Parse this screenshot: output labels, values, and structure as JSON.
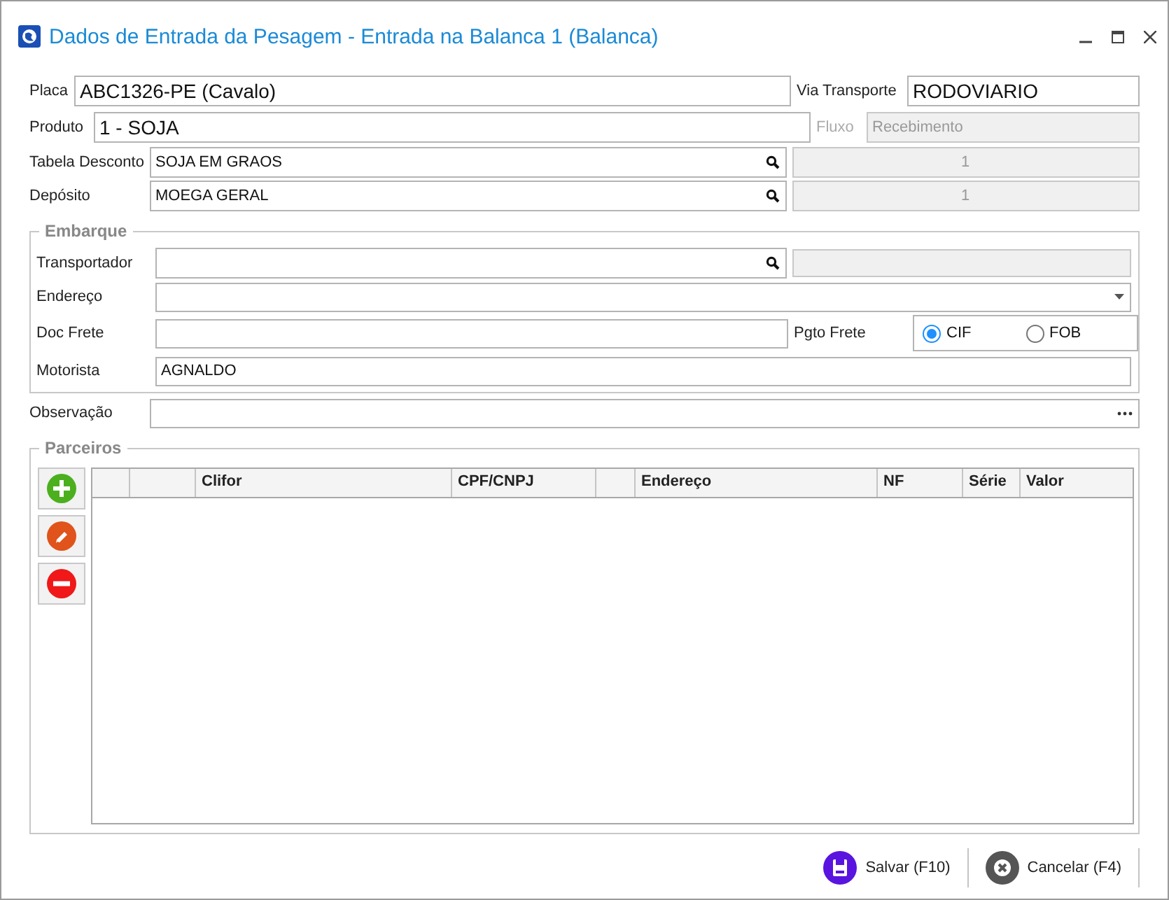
{
  "window": {
    "title": "Dados de Entrada da Pesagem - Entrada na Balanca 1 (Balanca)"
  },
  "placa": {
    "label": "Placa",
    "value": "ABC1326-PE (Cavalo)"
  },
  "via_transporte": {
    "label": "Via Transporte",
    "value": "RODOVIARIO"
  },
  "produto": {
    "label": "Produto",
    "value": "1 - SOJA"
  },
  "fluxo": {
    "label": "Fluxo",
    "value": "Recebimento",
    "disabled": true
  },
  "tabela_desconto": {
    "label": "Tabela Desconto",
    "value": "SOJA EM GRAOS",
    "code": "1"
  },
  "deposito": {
    "label": "Depósito",
    "value": "MOEGA GERAL",
    "code": "1"
  },
  "embarque": {
    "title": "Embarque",
    "transportador": {
      "label": "Transportador"
    },
    "endereco": {
      "label": "Endereço"
    },
    "doc_frete": {
      "label": "Doc Frete"
    },
    "pgto_frete": {
      "label": "Pgto Frete",
      "options": [
        {
          "label": "CIF",
          "selected": true
        },
        {
          "label": "FOB",
          "selected": false
        }
      ]
    },
    "motorista": {
      "label": "Motorista",
      "value": "AGNALDO"
    }
  },
  "observacao": {
    "label": "Observação"
  },
  "parceiros": {
    "title": "Parceiros",
    "actions": [
      {
        "kind": "add"
      },
      {
        "kind": "edit"
      },
      {
        "kind": "remove"
      }
    ],
    "columns": [
      {
        "kind": "blank"
      },
      {
        "kind": "blank"
      },
      {
        "kind": "text",
        "label": "Clifor"
      },
      {
        "kind": "text",
        "label": "CPF/CNPJ"
      },
      {
        "kind": "blank"
      },
      {
        "kind": "text",
        "label": "Endereço"
      },
      {
        "kind": "text",
        "label": "NF"
      },
      {
        "kind": "text",
        "label": "Série"
      },
      {
        "kind": "text",
        "label": "Valor"
      }
    ]
  },
  "footer": [
    {
      "kind": "save",
      "label": "Salvar (F10)"
    },
    {
      "kind": "cancel",
      "label": "Cancelar (F4)"
    }
  ]
}
